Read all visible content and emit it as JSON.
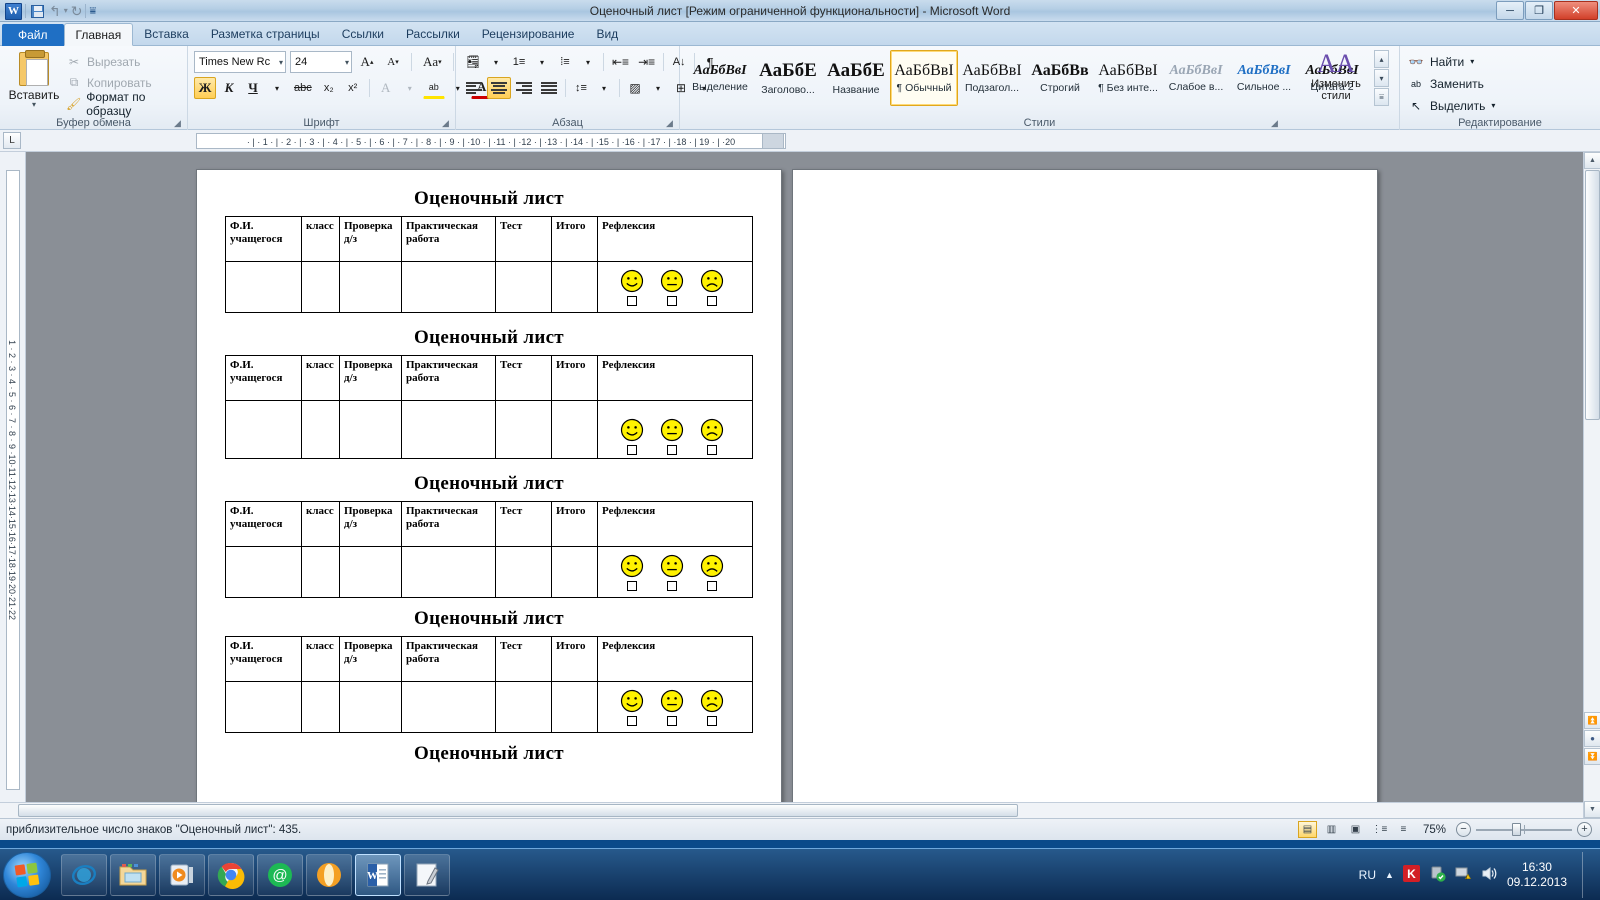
{
  "titlebar": {
    "app_icon": "word-logo-icon",
    "title": "Оценочный лист [Режим ограниченной функциональности]  -  Microsoft Word",
    "quick_access": [
      {
        "name": "save-icon",
        "glyph": ""
      },
      {
        "name": "undo-icon",
        "glyph": "↰"
      },
      {
        "name": "undo-dropdown-icon",
        "glyph": "▾"
      },
      {
        "name": "redo-icon",
        "glyph": "↻"
      },
      {
        "name": "customize-qat-icon",
        "glyph": "⬦"
      }
    ],
    "window_buttons": {
      "minimize": "─",
      "restore": "❐",
      "close": "✕"
    }
  },
  "tabs": [
    {
      "label": "Файл",
      "kind": "file"
    },
    {
      "label": "Главная",
      "kind": "active"
    },
    {
      "label": "Вставка",
      "kind": "normal"
    },
    {
      "label": "Разметка страницы",
      "kind": "normal"
    },
    {
      "label": "Ссылки",
      "kind": "normal"
    },
    {
      "label": "Рассылки",
      "kind": "normal"
    },
    {
      "label": "Рецензирование",
      "kind": "normal"
    },
    {
      "label": "Вид",
      "kind": "normal"
    }
  ],
  "ribbon": {
    "clipboard": {
      "group_label": "Буфер обмена",
      "paste_label": "Вставить",
      "items": [
        {
          "label": "Вырезать",
          "icon": "scissors-icon",
          "glyph": "✂",
          "dim": true
        },
        {
          "label": "Копировать",
          "icon": "copy-icon",
          "glyph": "⧉",
          "dim": true
        },
        {
          "label": "Формат по образцу",
          "icon": "format-painter-icon",
          "glyph": "🖌",
          "dim": false
        }
      ]
    },
    "font": {
      "group_label": "Шрифт",
      "font_name": "Times New Rc",
      "font_size": "24",
      "buttons_row1": [
        {
          "name": "grow-font-button",
          "glyph": "A▴"
        },
        {
          "name": "shrink-font-button",
          "glyph": "A▾"
        },
        {
          "name": "change-case-button",
          "glyph": "Aa▾"
        },
        {
          "name": "clear-formatting-button",
          "glyph": "🗒"
        }
      ],
      "buttons_row2": [
        {
          "name": "bold-button",
          "glyph": "Ж",
          "active": true
        },
        {
          "name": "italic-button",
          "glyph": "К",
          "active": false
        },
        {
          "name": "underline-button",
          "glyph": "Ч",
          "active": false
        },
        {
          "name": "strikethrough-button",
          "glyph": "abc",
          "active": false
        },
        {
          "name": "subscript-button",
          "glyph": "x₂",
          "active": false
        },
        {
          "name": "superscript-button",
          "glyph": "x²",
          "active": false
        },
        {
          "name": "text-effects-button",
          "glyph": "A",
          "active": false
        },
        {
          "name": "text-highlight-button",
          "glyph": "ab",
          "active": false
        },
        {
          "name": "font-color-button",
          "glyph": "A",
          "active": false
        }
      ]
    },
    "paragraph": {
      "group_label": "Абзац",
      "buttons_row1": [
        {
          "name": "bullets-button",
          "glyph": "☰"
        },
        {
          "name": "numbering-button",
          "glyph": "☰"
        },
        {
          "name": "multilevel-list-button",
          "glyph": "☰"
        },
        {
          "name": "decrease-indent-button",
          "glyph": "⇤"
        },
        {
          "name": "increase-indent-button",
          "glyph": "⇥"
        },
        {
          "name": "sort-button",
          "glyph": "А↓"
        },
        {
          "name": "show-formatting-marks-button",
          "glyph": "¶"
        }
      ],
      "buttons_row2": [
        {
          "name": "align-left-button",
          "glyph": "≡",
          "active": false
        },
        {
          "name": "align-center-button",
          "glyph": "≡",
          "active": true
        },
        {
          "name": "align-right-button",
          "glyph": "≡",
          "active": false
        },
        {
          "name": "justify-button",
          "glyph": "≡",
          "active": false
        },
        {
          "name": "line-spacing-button",
          "glyph": "↕☰"
        },
        {
          "name": "shading-button",
          "glyph": "▩"
        },
        {
          "name": "borders-button",
          "glyph": "⊞"
        }
      ]
    },
    "styles": {
      "group_label": "Стили",
      "gallery": [
        {
          "preview": "АаБбВвI",
          "name": "Выделение",
          "style": "italic-serif",
          "selected": false
        },
        {
          "preview": "АаБбЕ",
          "name": "Заголово...",
          "style": "bold-serif-lg",
          "selected": false
        },
        {
          "preview": "АаБбЕ",
          "name": "Название",
          "style": "bold-serif-lg",
          "selected": false
        },
        {
          "preview": "АаБбВвI",
          "name": "¶ Обычный",
          "style": "serif",
          "selected": true
        },
        {
          "preview": "АаБбВвI",
          "name": "Подзагол...",
          "style": "serif",
          "selected": false
        },
        {
          "preview": "АаБбВв",
          "name": "Строгий",
          "style": "bold-serif",
          "selected": false
        },
        {
          "preview": "АаБбВвI",
          "name": "¶ Без инте...",
          "style": "serif",
          "selected": false
        },
        {
          "preview": "АаБбВвI",
          "name": "Слабое в...",
          "style": "italic-gray",
          "selected": false
        },
        {
          "preview": "АаБбВвI",
          "name": "Сильное ...",
          "style": "bold-italic-blue",
          "selected": false
        },
        {
          "preview": "АаБбВвI",
          "name": "Цитата 2",
          "style": "italic-serif",
          "selected": false
        }
      ],
      "change_styles_label_1": "Изменить",
      "change_styles_label_2": "стили"
    },
    "editing": {
      "group_label": "Редактирование",
      "items": [
        {
          "label": "Найти",
          "icon": "binoculars-icon",
          "glyph": "🔍",
          "caret": "▾"
        },
        {
          "label": "Заменить",
          "icon": "replace-icon",
          "glyph": "ab",
          "caret": ""
        },
        {
          "label": "Выделить",
          "icon": "select-arrow-icon",
          "glyph": "↖",
          "caret": "▾"
        }
      ]
    }
  },
  "ruler": {
    "corner_button": "tab-stop-selector",
    "corner_glyph": "L",
    "horizontal_marks": "· | · 1 · | · 2 · | · 3 · | · 4 · | · 5 · | · 6 · | · 7 · | · 8 · | · 9 · | ·10 · | ·11 · | ·12 · | ·13 · | ·14 · | ·15 · | ·16 · | ·17 · | ·18 · | 19 · | ·20",
    "vertical_marks": "1 · 2 · 3 · 4 · 5 · 6 · 7 · 8 · 9 ·10·11·12·13·14·15·16·17·18·19·20·21·22"
  },
  "document": {
    "sheet_title": "Оценочный лист",
    "columns": [
      "Ф.И. учащегося",
      "класс",
      "Проверка д/з",
      "Практическая работа",
      "Тест",
      "Итого",
      "Рефлексия"
    ],
    "faces": [
      {
        "name": "happy-face-icon",
        "mood": "happy",
        "color": "#FFF200"
      },
      {
        "name": "neutral-face-icon",
        "mood": "neutral",
        "color": "#FFF200"
      },
      {
        "name": "sad-face-icon",
        "mood": "sad",
        "color": "#FFF200"
      }
    ],
    "sheet_count": 5
  },
  "statusbar": {
    "word_count_text": "приблизительное число знаков \"Оценочный лист\": 435.",
    "view_buttons": [
      {
        "name": "print-layout-view-button",
        "glyph": "▤",
        "active": true
      },
      {
        "name": "full-screen-reading-view-button",
        "glyph": "▥",
        "active": false
      },
      {
        "name": "web-layout-view-button",
        "glyph": "▣",
        "active": false
      },
      {
        "name": "outline-view-button",
        "glyph": "⋮≡",
        "active": false
      },
      {
        "name": "draft-view-button",
        "glyph": "≡",
        "active": false
      }
    ],
    "zoom_level": "75%",
    "zoom_out": "−",
    "zoom_in": "+"
  },
  "taskbar": {
    "start_button": "start-orb-icon",
    "items": [
      {
        "name": "internet-explorer-icon",
        "label": "Internet Explorer",
        "active": false
      },
      {
        "name": "file-explorer-icon",
        "label": "Проводник",
        "active": false
      },
      {
        "name": "media-player-icon",
        "label": "Windows Media Player",
        "active": false
      },
      {
        "name": "google-chrome-icon",
        "label": "Google Chrome",
        "active": false
      },
      {
        "name": "mail-agent-icon",
        "label": "Mail.ru Агент",
        "active": false
      },
      {
        "name": "opera-icon",
        "label": "Opera",
        "active": false
      },
      {
        "name": "microsoft-word-icon",
        "label": "Microsoft Word",
        "active": true
      },
      {
        "name": "notepad-icon",
        "label": "Блокнот",
        "active": false
      }
    ],
    "tray": {
      "language": "RU",
      "show_hidden_glyph": "▲",
      "icons": [
        {
          "name": "kaspersky-icon",
          "glyph": "K"
        },
        {
          "name": "safely-remove-hardware-icon",
          "glyph": "⏻"
        },
        {
          "name": "network-warning-icon",
          "glyph": "⚠"
        },
        {
          "name": "volume-icon",
          "glyph": "🔊"
        }
      ],
      "time": "16:30",
      "date": "09.12.2013"
    }
  }
}
